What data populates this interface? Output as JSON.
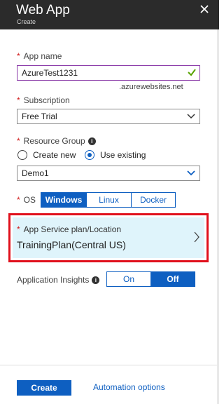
{
  "header": {
    "title": "Web App",
    "subtitle": "Create",
    "close_icon": "close-icon"
  },
  "app_name": {
    "label": "App name",
    "value": "AzureTest1231",
    "suffix": ".azurewebsites.net",
    "valid_icon": "checkmark-icon"
  },
  "subscription": {
    "label": "Subscription",
    "value": "Free Trial"
  },
  "resource_group": {
    "label": "Resource Group",
    "info_icon": "info-icon",
    "options": [
      "Create new",
      "Use existing"
    ],
    "selected": "Use existing",
    "value": "Demo1"
  },
  "os": {
    "label": "OS",
    "options": [
      "Windows",
      "Linux",
      "Docker"
    ],
    "selected": "Windows"
  },
  "app_service_plan": {
    "label": "App Service plan/Location",
    "value": "TrainingPlan(Central US)"
  },
  "app_insights": {
    "label": "Application Insights",
    "options": [
      "On",
      "Off"
    ],
    "selected": "Off"
  },
  "footer": {
    "create_label": "Create",
    "automation_label": "Automation options"
  },
  "colors": {
    "accent": "#0e5fc1",
    "header_bg": "#2b2b2b",
    "highlight": "#e0101c",
    "plan_bg": "#dff4fb",
    "required": "#d11a1a"
  }
}
